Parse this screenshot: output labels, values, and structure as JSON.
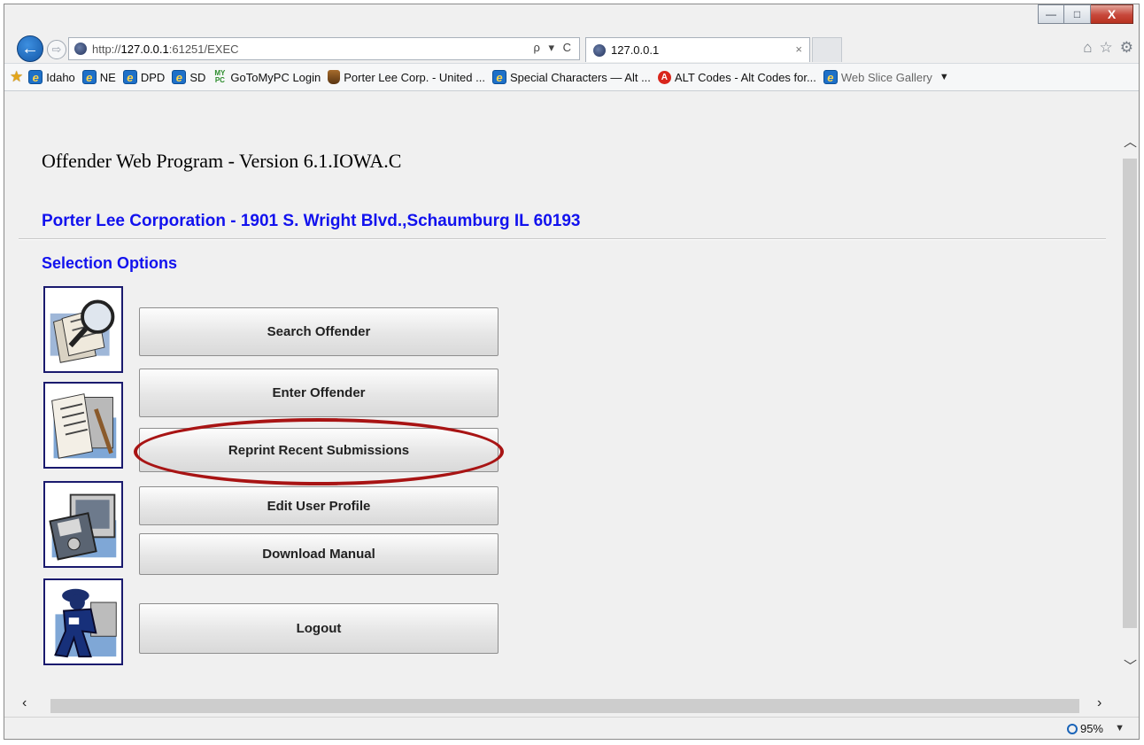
{
  "browser": {
    "address": {
      "scheme": "http://",
      "host": "127.0.0.1",
      "rest": ":61251/EXEC",
      "controls": "ρ ▾ C"
    },
    "tab": {
      "title": "127.0.0.1",
      "close": "×"
    },
    "tools": {
      "home": "⌂",
      "favorites": "☆",
      "settings": "⚙"
    },
    "window": {
      "minimize": "—",
      "maximize": "□",
      "close": "X"
    },
    "nav": {
      "back": "←",
      "forward": "⇨"
    }
  },
  "favorites": [
    {
      "label": "Idaho",
      "icon": "ie-icon"
    },
    {
      "label": "NE",
      "icon": "ie-icon"
    },
    {
      "label": "DPD",
      "icon": "ie-icon"
    },
    {
      "label": "SD",
      "icon": "ie-icon"
    },
    {
      "label": "GoToMyPC Login",
      "icon": "mypc-icon"
    },
    {
      "label": "Porter Lee Corp. - United ...",
      "icon": "porterlee-icon"
    },
    {
      "label": "Special Characters — Alt ...",
      "icon": "ie-icon"
    },
    {
      "label": "ALT Codes - Alt Codes for...",
      "icon": "altcodes-icon"
    },
    {
      "label": "Web Slice Gallery",
      "icon": "ie-icon"
    }
  ],
  "page": {
    "title": "Offender Web Program - Version 6.1.IOWA.C",
    "company": "Porter Lee Corporation - 1901 S. Wright Blvd.,Schaumburg IL 60193",
    "selection_title": "Selection Options",
    "buttons": {
      "search": "Search Offender",
      "enter": "Enter Offender",
      "reprint": "Reprint Recent Submissions",
      "edit_profile": "Edit User Profile",
      "download": "Download Manual",
      "logout": "Logout"
    }
  },
  "status": {
    "zoom": "95%"
  },
  "colors": {
    "link_blue": "#1212ee",
    "highlight_red": "#a81414",
    "back_button": "#1e6fc8"
  }
}
